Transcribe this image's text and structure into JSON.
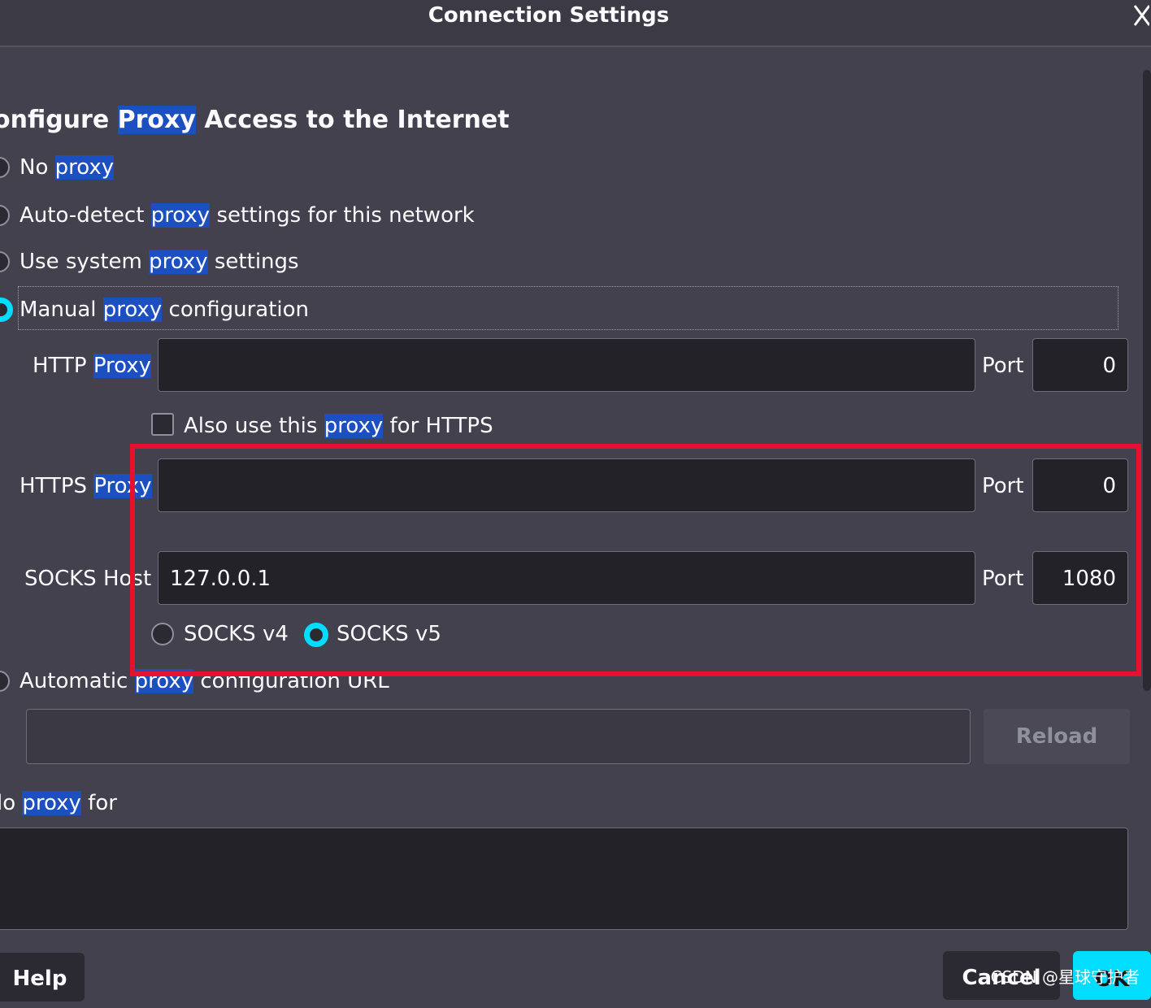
{
  "window": {
    "title": "Connection Settings"
  },
  "heading": {
    "pre": "onfigure ",
    "hl": "Proxy",
    "post": " Access to the Internet"
  },
  "options": {
    "no_proxy": {
      "pre": "No ",
      "hl": "proxy",
      "post": ""
    },
    "auto_detect": {
      "pre": "Auto-detect ",
      "hl": "proxy",
      "post": " settings for this network"
    },
    "system": {
      "pre": "Use system ",
      "hl": "proxy",
      "post": " settings"
    },
    "manual": {
      "pre": "Manual ",
      "hl": "proxy",
      "post": " configuration"
    },
    "auto_url": {
      "pre": "Automatic ",
      "hl": "proxy",
      "post": " configuration URL"
    }
  },
  "http": {
    "label_pre": "HTTP ",
    "label_hl": "Proxy",
    "value": "",
    "port_label": "Port",
    "port": "0"
  },
  "also_https": {
    "pre": "Also use this ",
    "hl": "proxy",
    "post": " for HTTPS",
    "checked": false
  },
  "https": {
    "label_pre": "HTTPS ",
    "label_hl": "Proxy",
    "value": "",
    "port_label": "Port",
    "port": "0"
  },
  "socks": {
    "label": "SOCKS Host",
    "value": "127.0.0.1",
    "port_label": "Port",
    "port": "1080",
    "v4": "SOCKS v4",
    "v5": "SOCKS v5",
    "selected": "SOCKS v5"
  },
  "auto_url_field": {
    "value": ""
  },
  "reload": "Reload",
  "no_proxy_for": {
    "pre": "lo ",
    "hl": "proxy",
    "post": " for",
    "value": ""
  },
  "buttons": {
    "help": "Help",
    "cancel": "Cancel",
    "ok": "OK"
  },
  "watermark": "CSDN @星球守护者",
  "colors": {
    "accent": "#00ddff",
    "highlight": "#1c4fbf",
    "annotation": "#e8112d"
  }
}
